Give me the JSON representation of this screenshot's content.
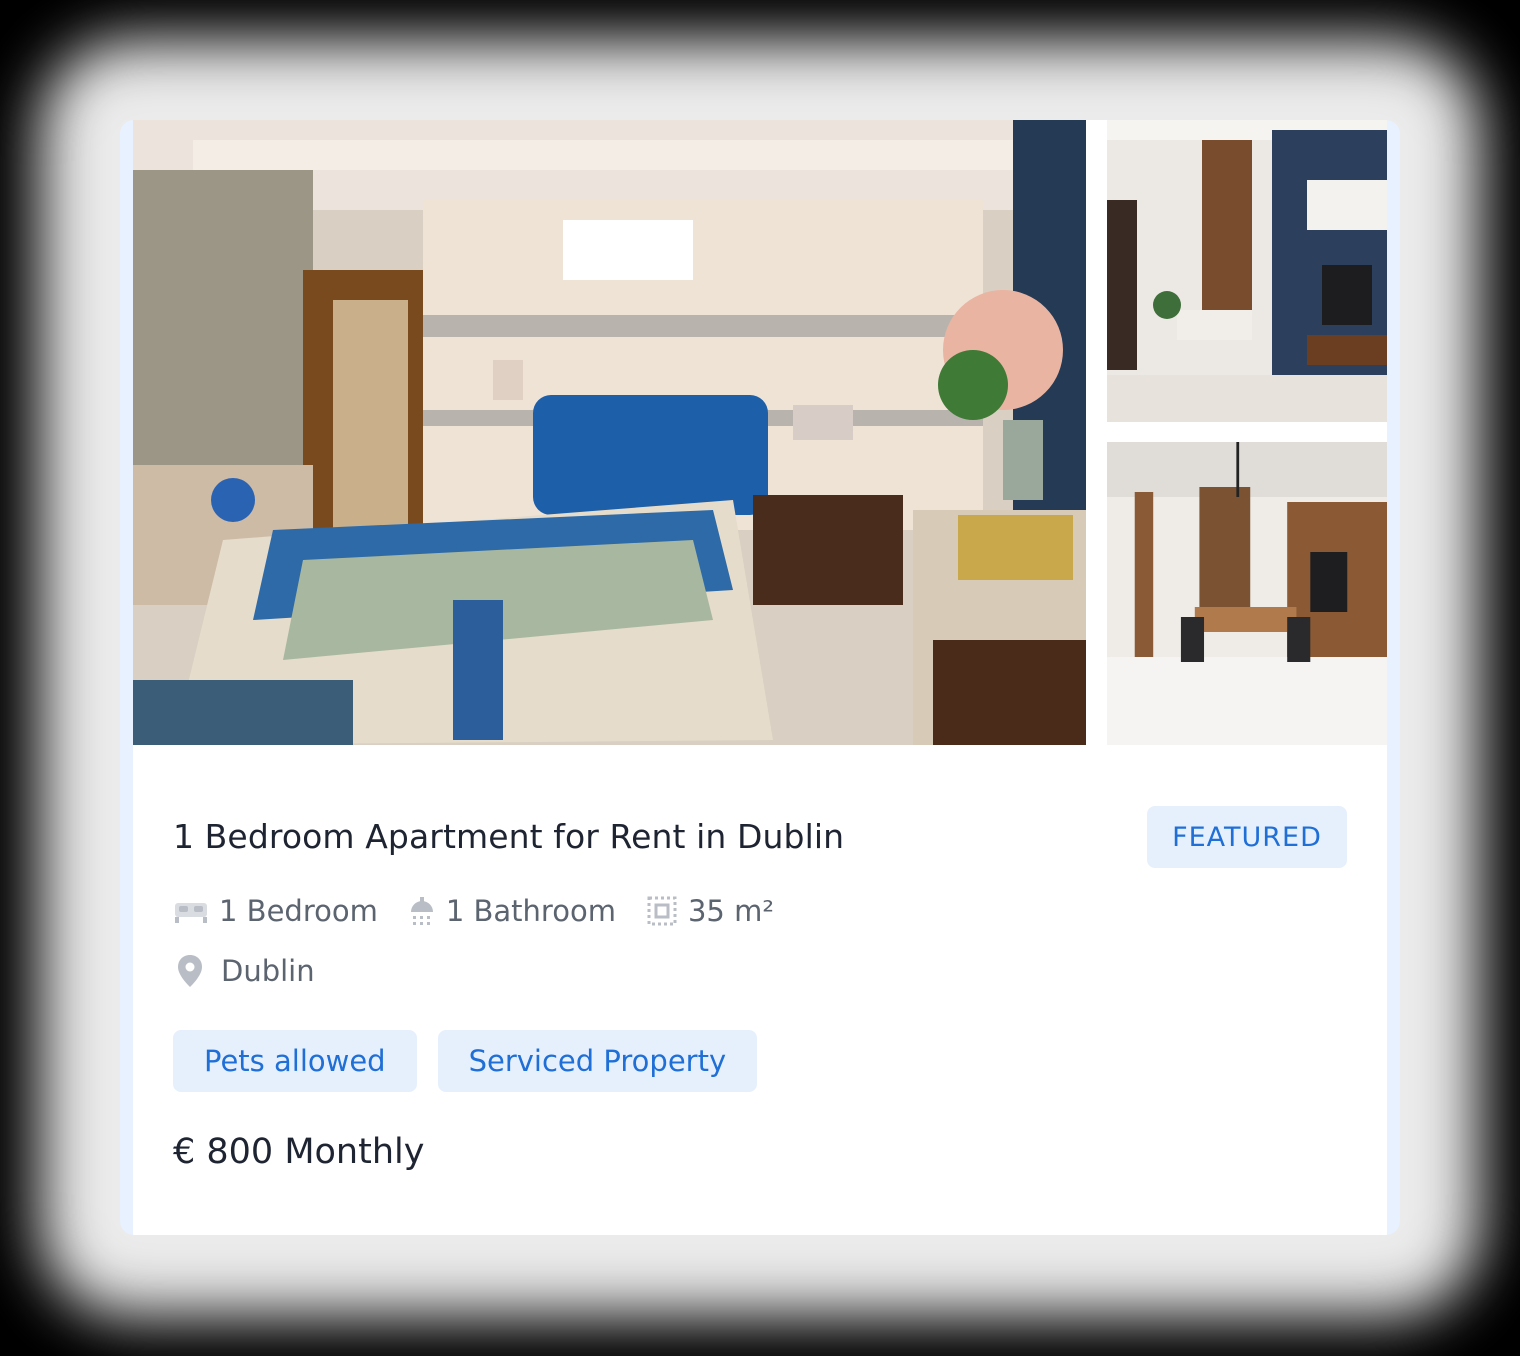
{
  "listing": {
    "title": "1 Bedroom Apartment for Rent in Dublin",
    "badge": "FEATURED",
    "specs": {
      "bedrooms": "1 Bedroom",
      "bathrooms": "1 Bathroom",
      "area": "35 m²"
    },
    "location": "Dublin",
    "tags": [
      "Pets allowed",
      "Serviced Property"
    ],
    "price": "€ 800 Monthly"
  },
  "icons": {
    "bed": "bed-icon",
    "bath": "shower-icon",
    "area": "area-icon",
    "location": "map-pin-icon"
  },
  "colors": {
    "accent": "#1f6fd6",
    "tag_bg": "#e6f0fd",
    "title": "#1e2432",
    "meta": "#5c6470"
  }
}
